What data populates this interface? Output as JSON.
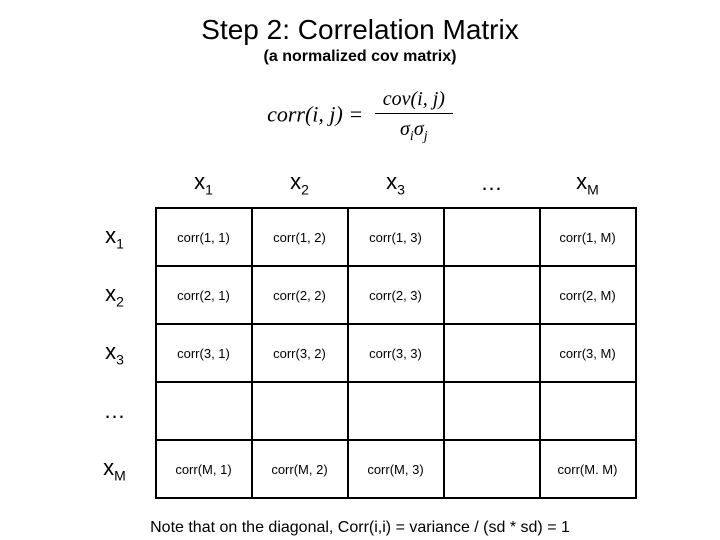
{
  "title": "Step 2: Correlation Matrix",
  "subtitle": "(a normalized cov matrix)",
  "formula": {
    "lhs": "corr(i, j) =",
    "numerator": "cov(i, j)",
    "denominator_sigma1": "σ",
    "denominator_sub1": "i",
    "denominator_sigma2": "σ",
    "denominator_sub2": "j"
  },
  "col_headers": {
    "c1_base": "x",
    "c1_sub": "1",
    "c2_base": "x",
    "c2_sub": "2",
    "c3_base": "x",
    "c3_sub": "3",
    "c4": "…",
    "c5_base": "x",
    "c5_sub": "M"
  },
  "row_headers": {
    "r1_base": "x",
    "r1_sub": "1",
    "r2_base": "x",
    "r2_sub": "2",
    "r3_base": "x",
    "r3_sub": "3",
    "r4": "…",
    "r5_base": "x",
    "r5_sub": "M"
  },
  "cells": {
    "r1c1": "corr(1, 1)",
    "r1c2": "corr(1, 2)",
    "r1c3": "corr(1, 3)",
    "r1c4": "",
    "r1c5": "corr(1, M)",
    "r2c1": "corr(2, 1)",
    "r2c2": "corr(2, 2)",
    "r2c3": "corr(2, 3)",
    "r2c4": "",
    "r2c5": "corr(2, M)",
    "r3c1": "corr(3, 1)",
    "r3c2": "corr(3, 2)",
    "r3c3": "corr(3, 3)",
    "r3c4": "",
    "r3c5": "corr(3, M)",
    "r4c1": "",
    "r4c2": "",
    "r4c3": "",
    "r4c4": "",
    "r4c5": "",
    "r5c1": "corr(M, 1)",
    "r5c2": "corr(M, 2)",
    "r5c3": "corr(M, 3)",
    "r5c4": "",
    "r5c5": "corr(M. M)"
  },
  "note": "Note that on the diagonal,  Corr(i,i) = variance / (sd * sd) = 1"
}
